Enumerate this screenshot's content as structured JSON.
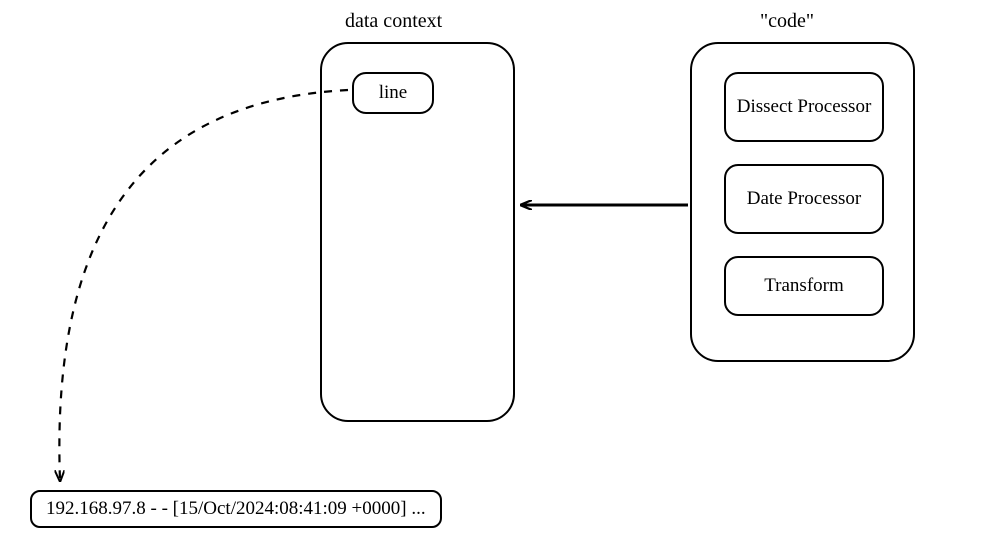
{
  "labels": {
    "data_context": "data context",
    "code": "\"code\""
  },
  "data_context": {
    "line_field": "line"
  },
  "code_box": {
    "processors": [
      "Dissect Processor",
      "Date Processor",
      "Transform"
    ]
  },
  "log_line": "192.168.97.8 - - [15/Oct/2024:08:41:09 +0000] ..."
}
